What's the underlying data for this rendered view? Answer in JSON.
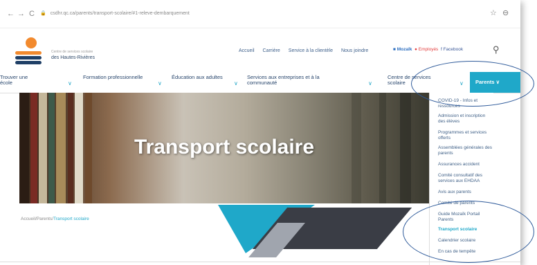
{
  "browser": {
    "back": "←",
    "forward": "→",
    "reload": "C",
    "url": "csdhr.qc.ca/parents/transport-scolaire/#1-releve-dembarquement",
    "star_icon": "star-icon",
    "account_icon": "account-icon"
  },
  "logo": {
    "line1": "Centre de services scolaire",
    "line2": "des Hautes-Rivières"
  },
  "top_links": [
    "Accueil",
    "Carrière",
    "Service à la clientèle",
    "Nous joindre"
  ],
  "social": {
    "mozaik": "Mozaïk",
    "employes": "Employés",
    "facebook": "Facebook"
  },
  "menu": [
    {
      "label": "Trouver une école"
    },
    {
      "label": "Formation professionnelle"
    },
    {
      "label": "Éducation aux adultes"
    },
    {
      "label": "Services aux entreprises et à la communauté"
    },
    {
      "label": "Centre de services scolaire"
    },
    {
      "label": "Parents"
    }
  ],
  "hero": {
    "title": "Transport scolaire"
  },
  "dropdown": [
    "COVID-19 - Infos et ressources",
    "Admission et inscription des élèves",
    "Programmes et services offerts",
    "Assemblées générales des parents",
    "Assurances accident",
    "Comité consultatif des services aux EHDAA",
    "Avis aux parents",
    "Comité de parents",
    "Guide Mozaïk Portail Parents",
    "Transport scolaire",
    "Calendrier scolaire",
    "En cas de tempête"
  ],
  "breadcrumb": {
    "home": "Accueil",
    "sep1": "/",
    "parents": "Parents",
    "sep2": "/",
    "current": "Transport scolaire"
  },
  "colors": {
    "accent": "#1fa8c9",
    "navy": "#26446b",
    "annotation": "#2e5a9a"
  }
}
